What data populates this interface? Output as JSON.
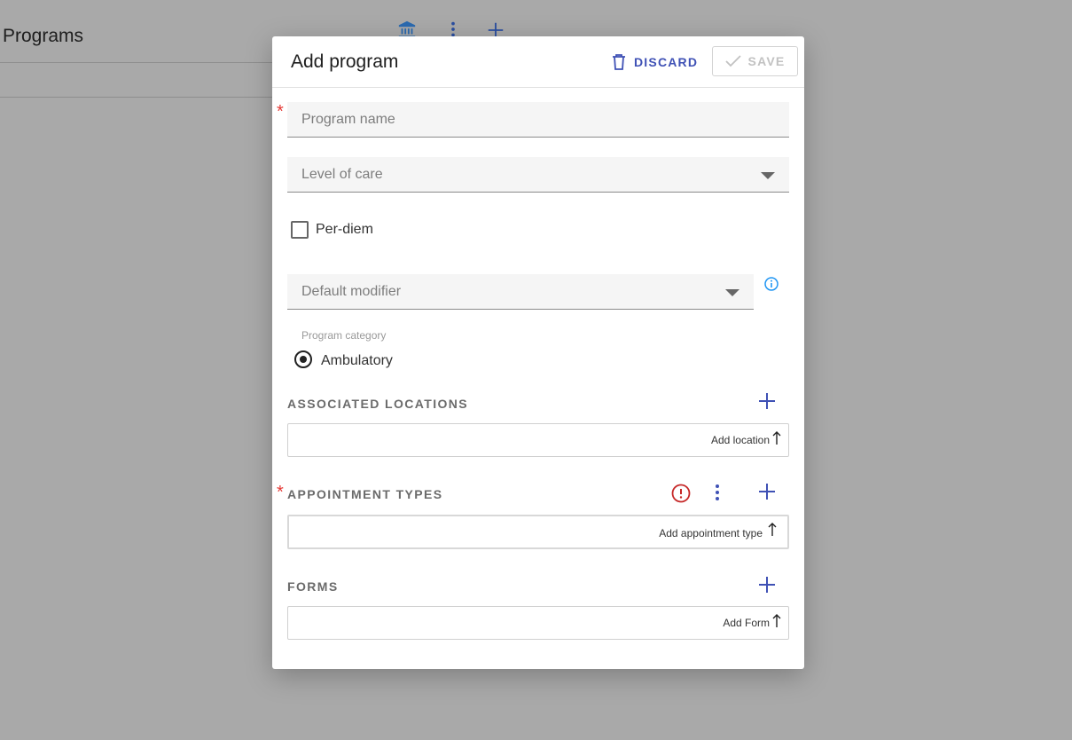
{
  "background": {
    "title": "Programs",
    "icons": [
      "bank-icon",
      "more-vert-icon",
      "add-icon"
    ]
  },
  "dialog": {
    "title": "Add program",
    "discard_label": "DISCARD",
    "save_label": "SAVE",
    "program_name_placeholder": "Program name",
    "level_of_care_placeholder": "Level of care",
    "per_diem_label": "Per-diem",
    "per_diem_checked": false,
    "default_modifier_placeholder": "Default modifier",
    "program_category_label": "Program category",
    "program_category_selected": "Ambulatory",
    "associated_locations": {
      "title": "ASSOCIATED LOCATIONS",
      "add_label": "Add location"
    },
    "appointment_types": {
      "title": "APPOINTMENT TYPES",
      "add_label": "Add appointment type"
    },
    "forms": {
      "title": "FORMS",
      "add_label": "Add Form"
    }
  },
  "colors": {
    "accent": "#3f51b5",
    "required": "#e53935",
    "error": "#c62828",
    "info": "#2196f3",
    "overlay": "#a9a9a9"
  }
}
